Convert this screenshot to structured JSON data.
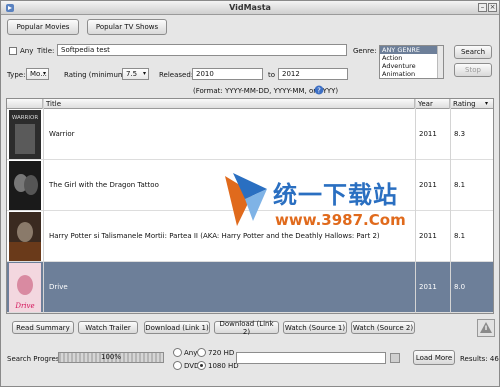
{
  "window": {
    "title": "VidMasta"
  },
  "top_buttons": {
    "popular_movies": "Popular Movies",
    "popular_tv": "Popular TV Shows"
  },
  "search": {
    "any_label": "Any",
    "title_label": "Title:",
    "title_value": "Softpedia test",
    "genre_label": "Genre:",
    "genres": [
      "ANY GENRE",
      "Action",
      "Adventure",
      "Animation"
    ],
    "search_button": "Search",
    "stop_button": "Stop",
    "type_label": "Type:",
    "type_value": "Mo...",
    "rating_label": "Rating (minimum):",
    "rating_value": "7.5",
    "released_label": "Released:",
    "released_from": "2010",
    "to_label": "to",
    "released_to": "2012",
    "format_hint": "(Format: YYYY-MM-DD, YYYY-MM, or YYYY)"
  },
  "table": {
    "columns": [
      "Title",
      "Year",
      "Rating"
    ],
    "rows": [
      {
        "title": "Warrior",
        "year": "2011",
        "rating": "8.3",
        "poster_text": "WARRIOR"
      },
      {
        "title": "The Girl with the Dragon Tattoo",
        "year": "2011",
        "rating": "8.1",
        "poster_text": ""
      },
      {
        "title": "Harry Potter si Talismanele Mortii: Partea II (AKA: Harry Potter and the Deathly Hallows: Part 2)",
        "year": "2011",
        "rating": "8.1",
        "poster_text": ""
      },
      {
        "title": "Drive",
        "year": "2011",
        "rating": "8.0",
        "poster_text": "Drive"
      }
    ],
    "selected_row": 3
  },
  "watermark": {
    "line1": "统一下载站",
    "line2": "www.3987.Com"
  },
  "actions": [
    "Read Summary",
    "Watch Trailer",
    "Download (Link 1)",
    "Download (Link 2)",
    "Watch (Source 1)",
    "Watch (Source 2)"
  ],
  "footer": {
    "progress_label": "Search Progress:",
    "progress_text": "100%",
    "progress_value": 1.0,
    "quality_options": [
      "Any",
      "720 HD",
      "DVD",
      "1080 HD"
    ],
    "quality_selected": "1080 HD",
    "load_more": "Load More",
    "results": "Results: 46"
  },
  "colors": {
    "selection": "#6d7f99",
    "watermark_blue": "#2a6fc1",
    "watermark_orange": "#e06a1c"
  }
}
